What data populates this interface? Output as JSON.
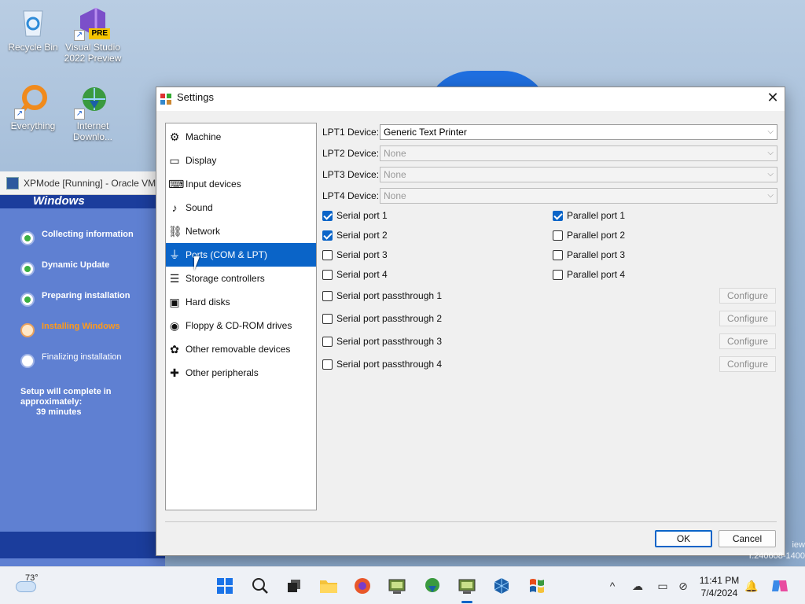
{
  "desktop": {
    "icons": [
      {
        "name": "recycle-bin",
        "label": "Recycle Bin"
      },
      {
        "name": "visual-studio",
        "label": "Visual Studio 2022 Preview",
        "badge": "PRE"
      },
      {
        "name": "everything",
        "label": "Everything"
      },
      {
        "name": "internet-download-manager",
        "label": "Internet Downlo..."
      }
    ],
    "eval_text": "iew\nr.240608-1400"
  },
  "vm_window": {
    "title": "XPMode [Running] - Oracle VM",
    "header_text": "Windows",
    "steps": [
      {
        "label": "Collecting information",
        "state": "done"
      },
      {
        "label": "Dynamic Update",
        "state": "done"
      },
      {
        "label": "Preparing installation",
        "state": "done"
      },
      {
        "label": "Installing Windows",
        "state": "active"
      },
      {
        "label": "Finalizing installation",
        "state": "pending"
      }
    ],
    "complete_text": "Setup will complete in approximately:",
    "minutes_text": "39 minutes"
  },
  "dialog": {
    "title": "Settings",
    "close_label": "✕",
    "nav": [
      {
        "label": "Machine",
        "icon": "machine-icon",
        "glyph": "⚙"
      },
      {
        "label": "Display",
        "icon": "display-icon",
        "glyph": "▭"
      },
      {
        "label": "Input devices",
        "icon": "input-devices-icon",
        "glyph": "⌨"
      },
      {
        "label": "Sound",
        "icon": "sound-icon",
        "glyph": "♪"
      },
      {
        "label": "Network",
        "icon": "network-icon",
        "glyph": "⛓"
      },
      {
        "label": "Ports (COM & LPT)",
        "icon": "ports-icon",
        "glyph": "⏚",
        "selected": true
      },
      {
        "label": "Storage controllers",
        "icon": "storage-icon",
        "glyph": "☰"
      },
      {
        "label": "Hard disks",
        "icon": "hard-disk-icon",
        "glyph": "▣"
      },
      {
        "label": "Floppy & CD-ROM drives",
        "icon": "floppy-icon",
        "glyph": "◉"
      },
      {
        "label": "Other removable devices",
        "icon": "removable-icon",
        "glyph": "✿"
      },
      {
        "label": "Other peripherals",
        "icon": "peripherals-icon",
        "glyph": "✚"
      }
    ],
    "lpt": [
      {
        "label": "LPT1 Device:",
        "value": "Generic Text Printer",
        "enabled": true
      },
      {
        "label": "LPT2 Device:",
        "value": "None",
        "enabled": false
      },
      {
        "label": "LPT3 Device:",
        "value": "None",
        "enabled": false
      },
      {
        "label": "LPT4 Device:",
        "value": "None",
        "enabled": false
      }
    ],
    "serial": [
      {
        "label": "Serial port 1",
        "checked": true
      },
      {
        "label": "Serial port 2",
        "checked": true
      },
      {
        "label": "Serial port 3",
        "checked": false
      },
      {
        "label": "Serial port 4",
        "checked": false
      }
    ],
    "parallel": [
      {
        "label": "Parallel port 1",
        "checked": true
      },
      {
        "label": "Parallel port 2",
        "checked": false
      },
      {
        "label": "Parallel port 3",
        "checked": false
      },
      {
        "label": "Parallel port 4",
        "checked": false
      }
    ],
    "passthrough": [
      {
        "label": "Serial port passthrough 1",
        "checked": false
      },
      {
        "label": "Serial port passthrough 2",
        "checked": false
      },
      {
        "label": "Serial port passthrough 3",
        "checked": false
      },
      {
        "label": "Serial port passthrough 4",
        "checked": false
      }
    ],
    "configure_label": "Configure",
    "ok_label": "OK",
    "cancel_label": "Cancel"
  },
  "taskbar": {
    "weather_temp": "73°",
    "apps": [
      {
        "name": "start-button",
        "glyph": "⊞",
        "color": "#1a73e8"
      },
      {
        "name": "search-icon",
        "glyph": "🔍",
        "color": "#222"
      },
      {
        "name": "task-view-icon",
        "glyph": "▣",
        "color": "#222"
      },
      {
        "name": "file-explorer-icon",
        "glyph": "📁",
        "color": "#e6a817"
      },
      {
        "name": "firefox-icon",
        "glyph": "●",
        "color": "#e8572a"
      },
      {
        "name": "pcem-icon",
        "glyph": "▦",
        "color": "#6a8a3a"
      },
      {
        "name": "idm-icon",
        "glyph": "◍",
        "color": "#2a8a3a"
      },
      {
        "name": "pcem-running-icon",
        "glyph": "▦",
        "color": "#6a8a3a",
        "running": true
      },
      {
        "name": "virtualbox-icon",
        "glyph": "⬢",
        "color": "#1b5fa8"
      },
      {
        "name": "windows-xp-icon",
        "glyph": "❖",
        "color": "#e84c1a"
      }
    ],
    "time": "11:41 PM",
    "date": "7/4/2024"
  },
  "colors": {
    "accent": "#0a64c8",
    "xp_blue": "#5f80d2",
    "xp_orange": "#ff9a1a"
  }
}
